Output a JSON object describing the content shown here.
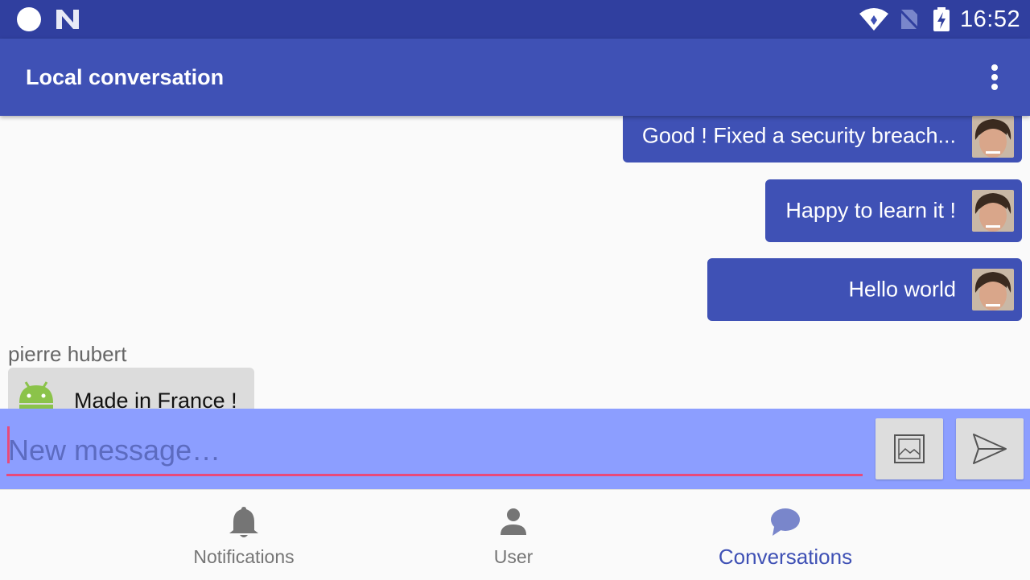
{
  "status_bar": {
    "time": "16:52"
  },
  "app_bar": {
    "title": "Local conversation"
  },
  "messages": {
    "outgoing": [
      {
        "text": "Good ! Fixed a security breach..."
      },
      {
        "text": "Happy to learn it !"
      },
      {
        "text": "Hello world"
      }
    ],
    "incoming": {
      "sender": "pierre hubert",
      "text": "Made in France !"
    }
  },
  "composer": {
    "placeholder": "New message…"
  },
  "bottom_nav": {
    "items": [
      {
        "label": "Notifications",
        "icon": "bell-icon"
      },
      {
        "label": "User",
        "icon": "user-icon"
      },
      {
        "label": "Conversations",
        "icon": "chat-bubble-icon",
        "active": true
      }
    ]
  },
  "colors": {
    "primary": "#3f51b5",
    "primary_dark": "#303f9f",
    "composer": "#8c9eff",
    "accent": "#e84a7a"
  }
}
